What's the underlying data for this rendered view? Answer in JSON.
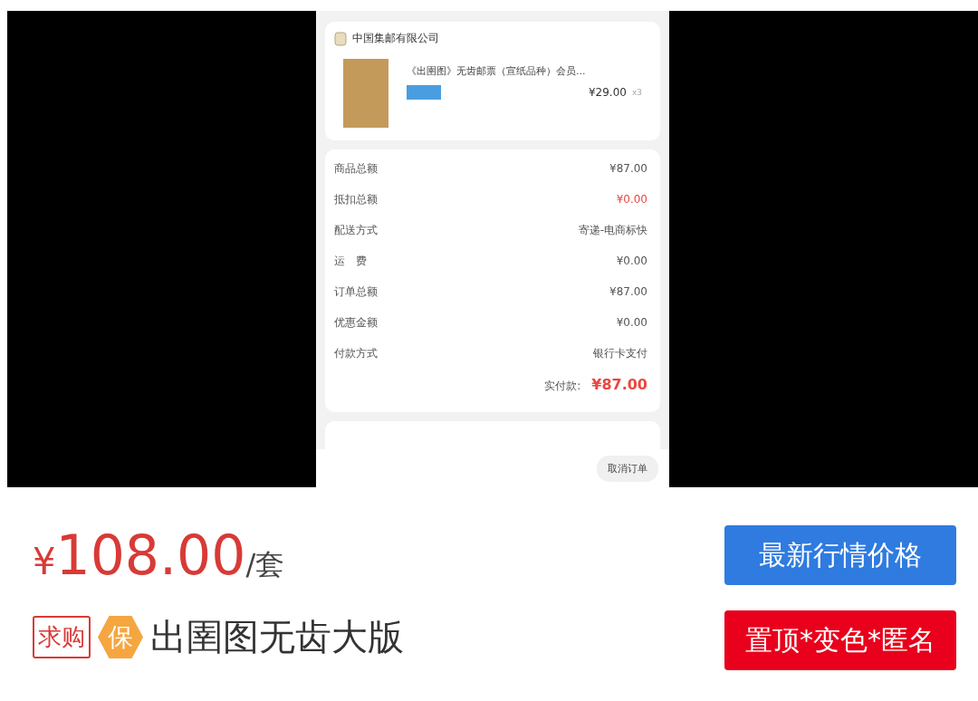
{
  "screenshot": {
    "shop_name": "中国集邮有限公司",
    "product": {
      "title": "《出圉图》无齿邮票（宣纸品种）会员...",
      "price": "¥29.00",
      "quantity": "x3"
    },
    "summary": [
      {
        "label": "商品总额",
        "value": "¥87.00",
        "highlight": false
      },
      {
        "label": "抵扣总额",
        "value": "¥0.00",
        "highlight": true
      },
      {
        "label": "配送方式",
        "value": "寄递-电商标快",
        "highlight": false
      },
      {
        "label": "运　费",
        "value": "¥0.00",
        "highlight": false
      },
      {
        "label": "订单总额",
        "value": "¥87.00",
        "highlight": false
      },
      {
        "label": "优惠金额",
        "value": "¥0.00",
        "highlight": false
      },
      {
        "label": "付款方式",
        "value": "银行卡支付",
        "highlight": false
      }
    ],
    "paid_label": "实付款:",
    "paid_value": "¥87.00",
    "cancel_button": "取消订单"
  },
  "listing": {
    "currency": "¥",
    "price": "108.00",
    "unit": "/套",
    "buttons": [
      {
        "label": "最新行情价格",
        "kind": "primary"
      },
      {
        "label": "置顶*变色*匿名",
        "kind": "danger"
      }
    ],
    "tag": "求购",
    "guarantee": "保",
    "title": "出圉图无齿大版"
  }
}
